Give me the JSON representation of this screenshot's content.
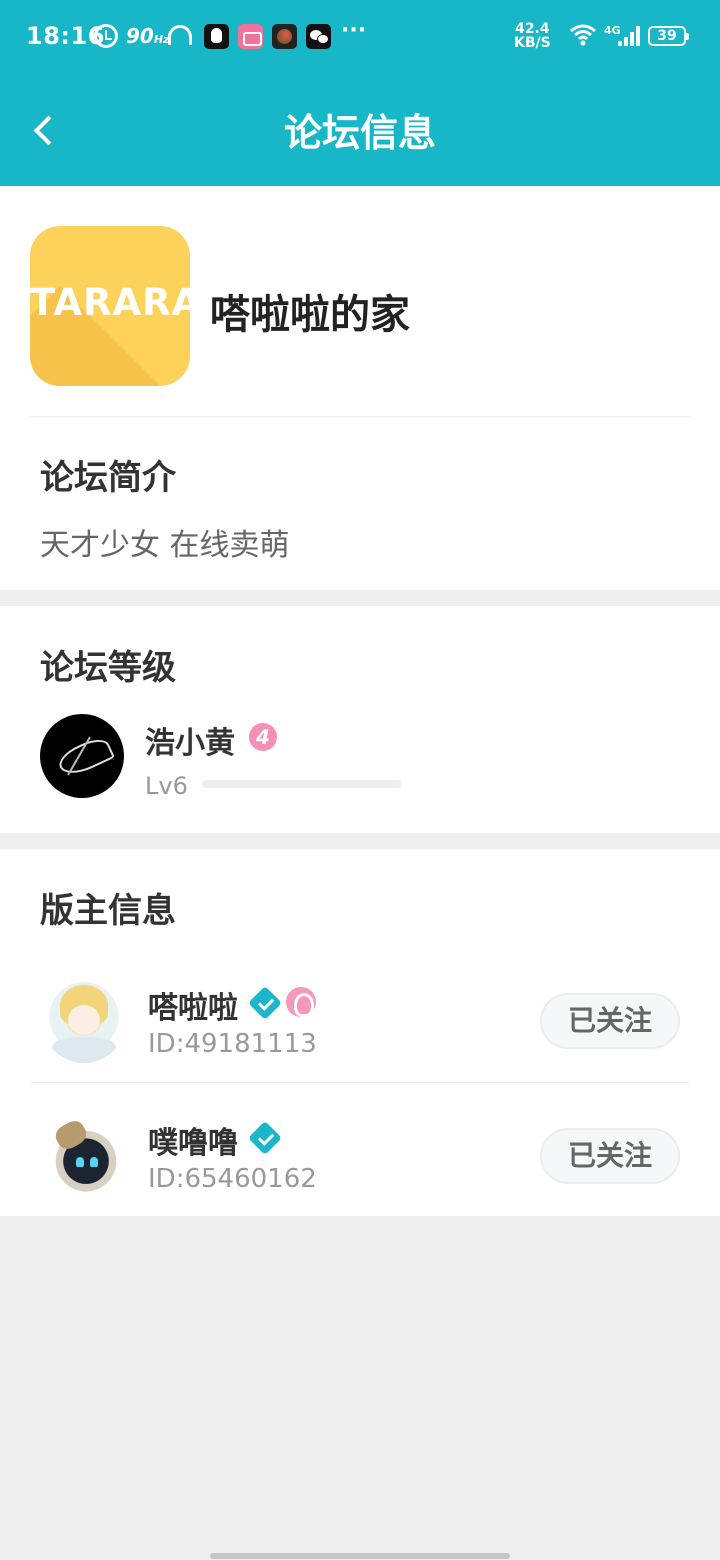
{
  "status_bar": {
    "time": "18:16",
    "refresh_rate": "90",
    "refresh_unit": "Hz",
    "more": "···",
    "speed_value": "42.4",
    "speed_unit": "KB/S",
    "network": "4G",
    "battery": "39"
  },
  "header": {
    "title": "论坛信息",
    "background_color": "#18b7c8"
  },
  "forum": {
    "logo_text": "TARARA",
    "name": "嗒啦啦的家",
    "intro_title": "论坛简介",
    "intro": "天才少女 在线卖萌"
  },
  "level": {
    "title": "论坛等级",
    "user_name": "浩小黄",
    "badge": "4",
    "level_label": "Lv6",
    "progress": 0.0
  },
  "moderators": {
    "title": "版主信息",
    "items": [
      {
        "name": "嗒啦啦",
        "id": "ID:49181113",
        "follow_label": "已关注",
        "verified": true,
        "extra_badge": true
      },
      {
        "name": "噗噜噜",
        "id": "ID:65460162",
        "follow_label": "已关注",
        "verified": true,
        "extra_badge": false
      }
    ]
  }
}
